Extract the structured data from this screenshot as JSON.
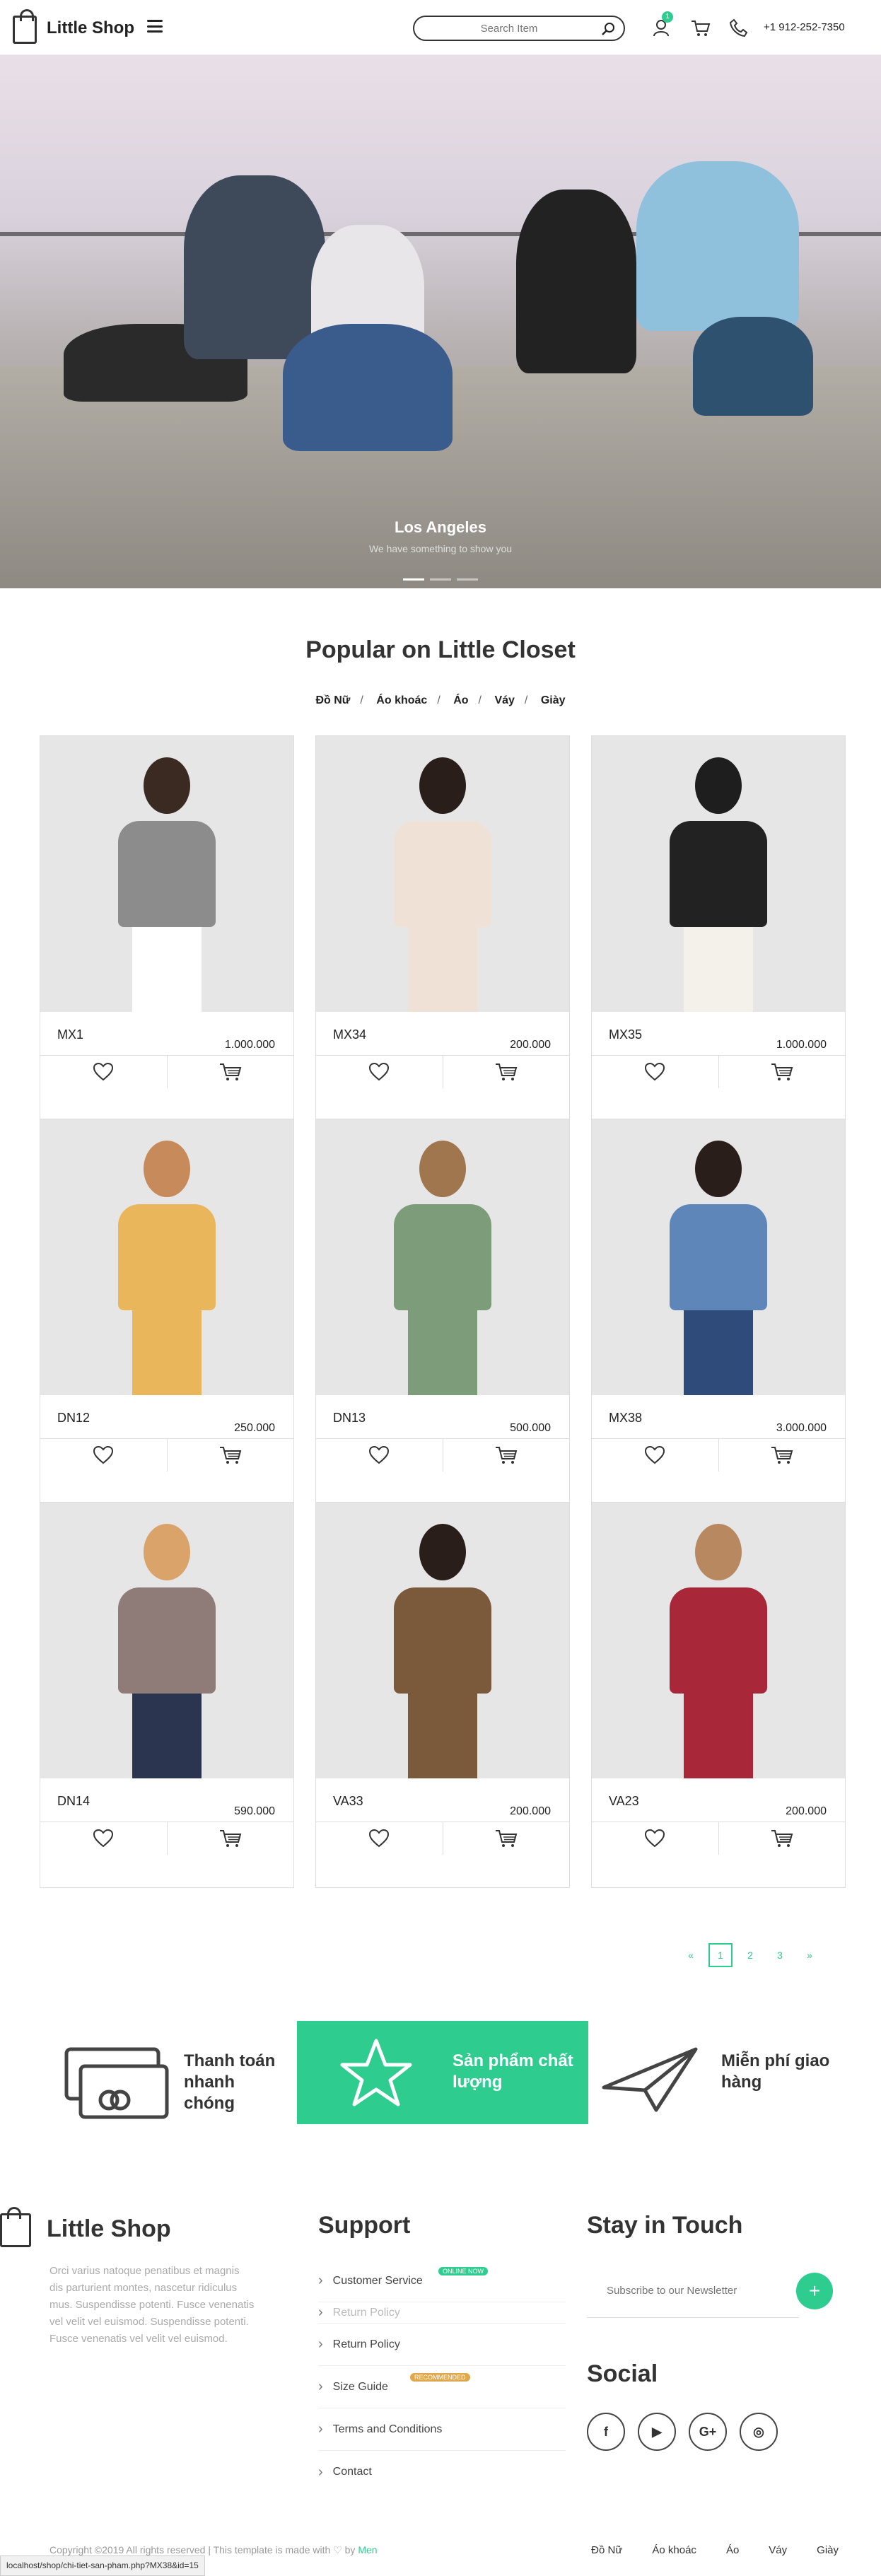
{
  "header": {
    "logo": "Little Shop",
    "search_placeholder": "Search Item",
    "notification_count": "1",
    "phone": "+1 912-252-7350"
  },
  "hero": {
    "title": "Los Angeles",
    "subtitle": "We have something to show you"
  },
  "popular": {
    "title": "Popular on Little Closet",
    "categories": [
      "Đồ Nữ",
      "Áo khoác",
      "Áo",
      "Váy",
      "Giày"
    ],
    "products": [
      {
        "name": "MX1",
        "price": "1.000.000"
      },
      {
        "name": "MX34",
        "price": "200.000"
      },
      {
        "name": "MX35",
        "price": "1.000.000"
      },
      {
        "name": "DN12",
        "price": "250.000"
      },
      {
        "name": "DN13",
        "price": "500.000"
      },
      {
        "name": "MX38",
        "price": "3.000.000"
      },
      {
        "name": "DN14",
        "price": "590.000"
      },
      {
        "name": "VA33",
        "price": "200.000"
      },
      {
        "name": "VA23",
        "price": "200.000"
      }
    ]
  },
  "pagination": {
    "prev": "«",
    "pages": [
      "1",
      "2",
      "3"
    ],
    "next": "»",
    "active": "1"
  },
  "features": [
    {
      "label": "Thanh toán nhanh chóng"
    },
    {
      "label": "Sản phẩm chất lượng"
    },
    {
      "label": "Miễn phí giao hàng"
    }
  ],
  "footer": {
    "brand": "Little Shop",
    "description": "Orci varius natoque penatibus et magnis dis parturient montes, nascetur ridiculus mus. Suspendisse potenti. Fusce venenatis vel velit vel euismod. Suspendisse potenti. Fusce venenatis vel velit vel euismod.",
    "support_title": "Support",
    "support_links": [
      "Customer Service",
      "Return Policy",
      "Return Policy",
      "Size Guide",
      "Terms and Conditions",
      "Contact"
    ],
    "tag_new": "ONLINE NOW",
    "tag_recommended": "RECOMMENDED",
    "touch_title": "Stay in Touch",
    "newsletter_placeholder": "Subscribe to our Newsletter",
    "newsletter_button": "+",
    "social_title": "Social",
    "social": [
      "f",
      "▶",
      "G+",
      "◎"
    ],
    "copyright_prefix": "Copyright ©2019 All rights reserved | This template is made with ♡ by",
    "copyright_author": "Men",
    "nav": [
      "Đồ Nữ",
      "Áo khoác",
      "Áo",
      "Váy",
      "Giày"
    ]
  },
  "statusbar": "localhost/shop/chi-tiet-san-pham.php?MX38&id=15",
  "colors": {
    "accent": "#2ecc8f",
    "text": "#333333"
  }
}
